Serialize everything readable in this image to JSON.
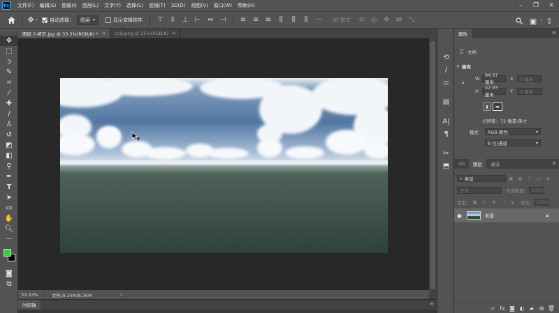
{
  "app": {
    "logo": "Ps"
  },
  "menu": [
    "文件(F)",
    "编辑(E)",
    "图像(I)",
    "图层(L)",
    "文字(Y)",
    "选择(S)",
    "滤镜(T)",
    "3D(D)",
    "视图(V)",
    "窗口(W)",
    "帮助(H)"
  ],
  "options": {
    "auto_select_label": "自动选择：",
    "auto_select_value": "图层",
    "show_transform_label": "显示变换控件",
    "mode_3d_label": "3D 模式："
  },
  "tabs": [
    {
      "label": "图层 0 拷贝.jpg @ 33.3%(RGB/8) *",
      "close": "×"
    },
    {
      "label": "ccly.png @ 25%(RGB/8)",
      "close": "×"
    }
  ],
  "status": {
    "zoom": "33.33%",
    "doc": "文档:8.36M/8.36M",
    "arrow": "›"
  },
  "timeline": {
    "label": "时间轴"
  },
  "properties": {
    "tab": "属性",
    "doc_label": "文档",
    "section": "画布",
    "w_label": "W",
    "w_value": "84.67 厘米",
    "h_label": "H",
    "h_value": "42.93 厘米",
    "x_label": "X",
    "x_placeholder": "0 厘米",
    "y_label": "Y",
    "y_placeholder": "0 厘米",
    "resolution": "分辨率：72 像素/英寸",
    "mode_label": "模式",
    "mode_value": "RGB 颜色",
    "depth_value": "8 位/通道"
  },
  "layers_panel": {
    "tabs": [
      "3D",
      "图层",
      "通道"
    ],
    "filter": "类型",
    "blend": "正常",
    "opacity_label": "不透明度：",
    "opacity_value": "100%",
    "lock_label": "锁定：",
    "fill_label": "填充：",
    "fill_value": "100%",
    "layers": [
      {
        "name": "背景",
        "visible": true,
        "locked": true
      }
    ]
  },
  "colors": {
    "foreground": "#2bd62b",
    "background": "#000000",
    "accent": "#31a8ff"
  }
}
